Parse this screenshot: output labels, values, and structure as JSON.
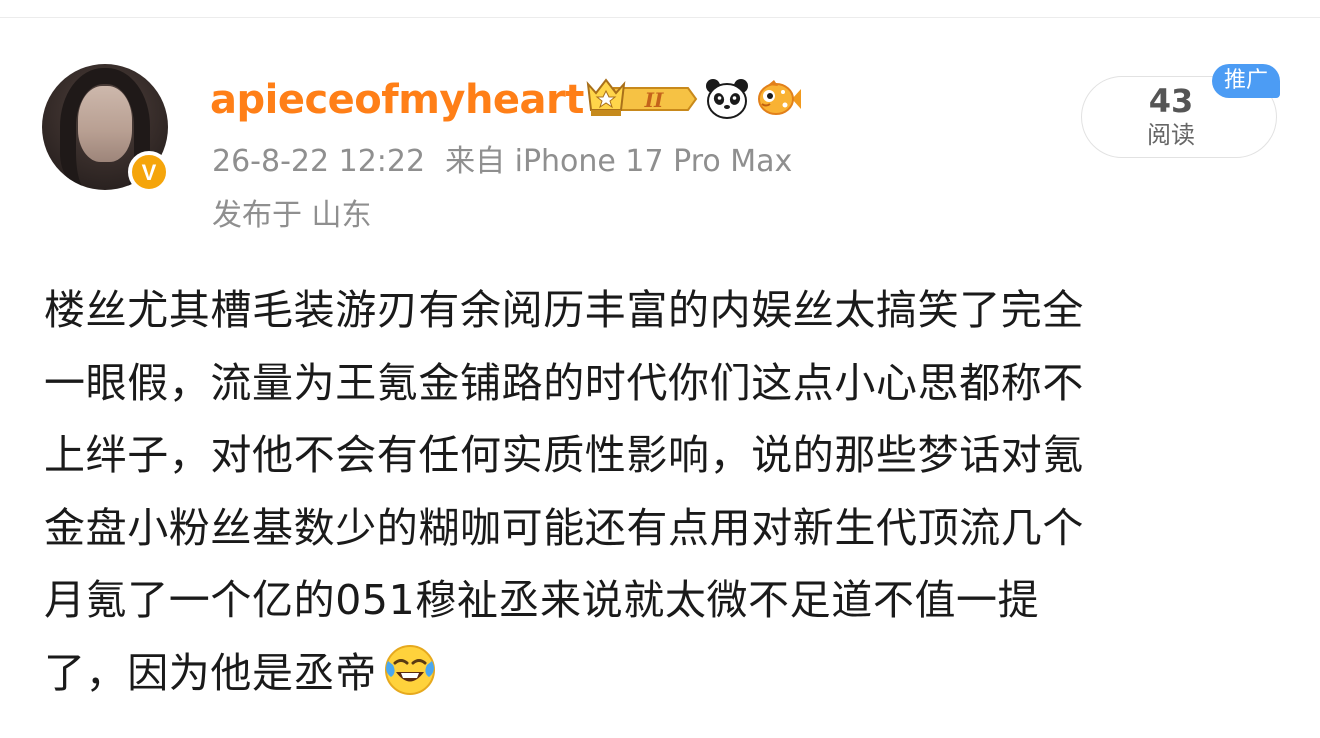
{
  "post": {
    "username": "apieceofmyheart",
    "timestamp": "26-8-22 12:22",
    "source": "来自 iPhone 17 Pro Max",
    "location": "发布于 山东",
    "read_count": "43",
    "read_label": "阅读",
    "promo_label": "推广",
    "level_badge": "II",
    "verified_badge": "V",
    "content_lines": [
      "楼丝尤其槽毛装游刃有余阅历丰富的内娱丝太搞笑了完全",
      "一眼假，流量为王氪金铺路的时代你们这点小心思都称不",
      "上绊子，对他不会有任何实质性影响，说的那些梦话对氪",
      "金盘小粉丝基数少的糊咖可能还有点用对新生代顶流几个",
      "月氪了一个亿的051穆祉丞来说就太微不足道不值一提",
      "了，因为他是丞帝"
    ],
    "icons": {
      "avatar": "user-avatar",
      "verified": "verified-v-icon",
      "crown": "crown-level-icon",
      "panda": "panda-icon",
      "fish": "fish-icon",
      "emoji": "laugh-cry-emoji"
    },
    "colors": {
      "username": "#ff7f17",
      "meta": "#8f8f8f",
      "promo": "#4c9cf4",
      "verified": "#f5a50b"
    }
  }
}
